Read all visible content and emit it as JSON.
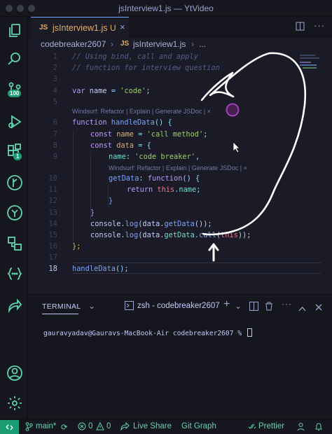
{
  "window": {
    "title": "jsInterview1.js — YtVideo"
  },
  "activity_bar": {
    "scm_badge": "100",
    "ext_badge": "1"
  },
  "editor": {
    "tab": {
      "lang": "JS",
      "name": "jsInterview1.js",
      "status": "U",
      "close": "×"
    },
    "breadcrumb": {
      "folder": "codebreaker2607",
      "sep": "›",
      "lang": "JS",
      "file": "jsInterview1.js",
      "sep2": "›",
      "tail": "..."
    },
    "codelens_1": "Windsurf: Refactor | Explain | Generate JSDoc | ×",
    "codelens_2": "Windsurf: Refactor | Explain | Generate JSDoc | ×",
    "line_numbers": [
      "1",
      "2",
      "3",
      "4",
      "5",
      "6",
      "7",
      "8",
      "9",
      "10",
      "11",
      "12",
      "13",
      "14",
      "15",
      "16",
      "17",
      "18"
    ],
    "lines": {
      "l1": "// Using bind, call and apply",
      "l2": "// function for interview question",
      "l4_kw": "var",
      "l4_name": " name ",
      "l4_eq": "= ",
      "l4_str": "'code'",
      "l4_end": ";",
      "l6_kw": "function",
      "l6_fn": " handleData",
      "l6_end": "() {",
      "l7_kw": "const",
      "l7_name": " name ",
      "l7_eq": "= ",
      "l7_str": "'call method'",
      "l7_end": ";",
      "l8_kw": "const",
      "l8_name": " data ",
      "l8_end": "= {",
      "l9_prop": "name",
      "l9_colon": ": ",
      "l9_str": "'code breaker'",
      "l9_end": ",",
      "l10_fn": "getData",
      "l10_colon": ": ",
      "l10_kw": "function",
      "l10_end": "() {",
      "l11_kw": "return",
      "l11_this": " this",
      "l11_dot": ".",
      "l11_prop": "name",
      "l11_end": ";",
      "l12": "}",
      "l13": "}",
      "l14_obj": "console",
      "l14_dot": ".",
      "l14_fn": "log",
      "l14_a": "(data.",
      "l14_fn2": "getData",
      "l14_b": "());",
      "l15_obj": "console",
      "l15_dot": ".",
      "l15_fn": "log",
      "l15_a": "(data.",
      "l15_prop": "getData",
      "l15_dot2": ".",
      "l15_fn2": "call",
      "l15_b": "(",
      "l15_this": "this",
      "l15_c": "));",
      "l16": "};",
      "l18_fn": "handleData",
      "l18_end": "();"
    }
  },
  "panel": {
    "tab_label": "TERMINAL",
    "more": "⌄",
    "terminal_name": "zsh - codebreaker2607",
    "add": "+",
    "prompt": "gauravyadav@Gauravs-MacBook-Air codebreaker2607 % "
  },
  "status_bar": {
    "remote": "⌄⌃",
    "branch": "main*",
    "sync": "⟳",
    "errors": "0",
    "warnings": "0",
    "live_share": "Live Share",
    "git_graph": "Git Graph",
    "prettier": "Prettier"
  },
  "colors": {
    "accent": "#5fd4b3",
    "background": "#1a1b26",
    "keyword": "#bb9af7",
    "string": "#9ece6a",
    "function": "#7aa2f7"
  }
}
